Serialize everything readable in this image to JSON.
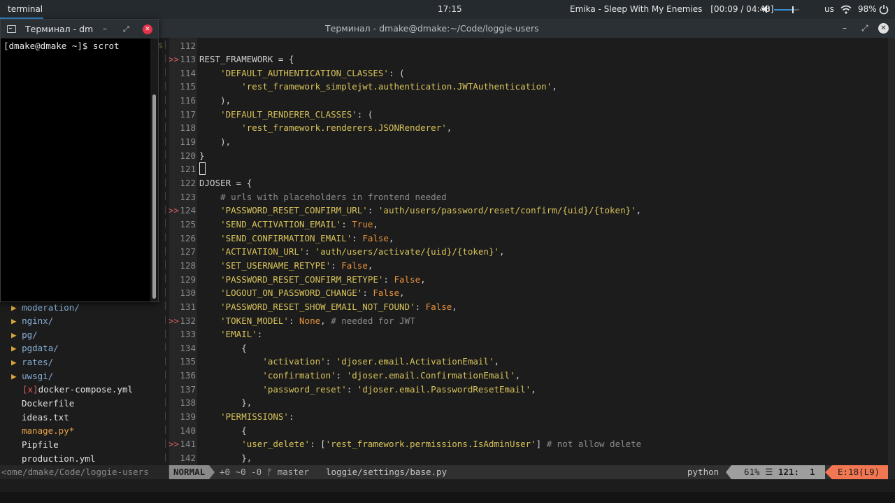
{
  "topbar": {
    "app_label": "terminal",
    "clock": "17:15",
    "media": {
      "artist": "Emika",
      "separator": "-",
      "track": "Sleep With My Enemies",
      "position": "[00:09 / 04:48]"
    },
    "volume_level": 0.75,
    "keyboard_layout": "us",
    "battery": "98%",
    "icons": [
      "volume-icon",
      "wifi-icon",
      "power-icon"
    ]
  },
  "window": {
    "title": "Терминал - dmake@dmake:~/Code/loggie-users",
    "minimize_glyph": "–",
    "maximize_glyph": "⤢",
    "close_glyph": "✕"
  },
  "float_terminal": {
    "title": "Терминал - dmake@dmake:~/Code/loggie-users",
    "prompt": "[dmake@dmake ~]$ scrot",
    "minimize_glyph": "–",
    "maximize_glyph": "⤢",
    "close_glyph": "✕"
  },
  "tree": {
    "marker": "s",
    "items": [
      {
        "arrow": "▶ ",
        "name": "moderation/",
        "type": "dir"
      },
      {
        "arrow": "▶ ",
        "name": "nginx/",
        "type": "dir"
      },
      {
        "arrow": "▶ ",
        "name": "pg/",
        "type": "dir"
      },
      {
        "arrow": "▶ ",
        "name": "pgdata/",
        "type": "dir"
      },
      {
        "arrow": "▶ ",
        "name": "rates/",
        "type": "dir"
      },
      {
        "arrow": "▶ ",
        "name": "uwsgi/",
        "type": "dir"
      },
      {
        "arrow": "",
        "flag": "[x]",
        "name": "docker-compose.yml",
        "type": "file"
      },
      {
        "arrow": "",
        "name": "Dockerfile",
        "type": "file"
      },
      {
        "arrow": "",
        "name": "ideas.txt",
        "type": "file"
      },
      {
        "arrow": "",
        "name": "manage.py*",
        "type": "modified"
      },
      {
        "arrow": "",
        "name": "Pipfile",
        "type": "file"
      },
      {
        "arrow": "",
        "name": "production.yml",
        "type": "file"
      }
    ]
  },
  "code": {
    "lines": [
      {
        "n": "112",
        "sign": "",
        "text": ""
      },
      {
        "n": "113",
        "sign": ">>",
        "text": "REST_FRAMEWORK = {"
      },
      {
        "n": "114",
        "sign": "",
        "text": "    'DEFAULT_AUTHENTICATION_CLASSES': ("
      },
      {
        "n": "115",
        "sign": "",
        "text": "        'rest_framework_simplejwt.authentication.JWTAuthentication',"
      },
      {
        "n": "116",
        "sign": "",
        "text": "    ),"
      },
      {
        "n": "117",
        "sign": "",
        "text": "    'DEFAULT_RENDERER_CLASSES': ("
      },
      {
        "n": "118",
        "sign": "",
        "text": "        'rest_framework.renderers.JSONRenderer',"
      },
      {
        "n": "119",
        "sign": "",
        "text": "    ),"
      },
      {
        "n": "120",
        "sign": "",
        "text": "}"
      },
      {
        "n": "121",
        "sign": "",
        "text": "",
        "cursor": true
      },
      {
        "n": "122",
        "sign": "",
        "text": "DJOSER = {"
      },
      {
        "n": "123",
        "sign": "",
        "text": "    # urls with placeholders in frontend needed"
      },
      {
        "n": "124",
        "sign": ">>",
        "text": "    'PASSWORD_RESET_CONFIRM_URL': 'auth/users/password/reset/confirm/{uid}/{token}',"
      },
      {
        "n": "125",
        "sign": "",
        "text": "    'SEND_ACTIVATION_EMAIL': True,"
      },
      {
        "n": "126",
        "sign": "",
        "text": "    'SEND_CONFIRMATION_EMAIL': False,"
      },
      {
        "n": "127",
        "sign": "",
        "text": "    'ACTIVATION_URL': 'auth/users/activate/{uid}/{token}',"
      },
      {
        "n": "128",
        "sign": "",
        "text": "    'SET_USERNAME_RETYPE': False,"
      },
      {
        "n": "129",
        "sign": "",
        "text": "    'PASSWORD_RESET_CONFIRM_RETYPE': False,"
      },
      {
        "n": "130",
        "sign": "",
        "text": "    'LOGOUT_ON_PASSWORD_CHANGE': False,"
      },
      {
        "n": "131",
        "sign": "",
        "text": "    'PASSWORD_RESET_SHOW_EMAIL_NOT_FOUND': False,"
      },
      {
        "n": "132",
        "sign": ">>",
        "text": "    'TOKEN_MODEL': None, # needed for JWT"
      },
      {
        "n": "133",
        "sign": "",
        "text": "    'EMAIL':"
      },
      {
        "n": "134",
        "sign": "",
        "text": "        {"
      },
      {
        "n": "135",
        "sign": "",
        "text": "            'activation': 'djoser.email.ActivationEmail',"
      },
      {
        "n": "136",
        "sign": "",
        "text": "            'confirmation': 'djoser.email.ConfirmationEmail',"
      },
      {
        "n": "137",
        "sign": "",
        "text": "            'password_reset': 'djoser.email.PasswordResetEmail',"
      },
      {
        "n": "138",
        "sign": "",
        "text": "        },"
      },
      {
        "n": "139",
        "sign": "",
        "text": "    'PERMISSIONS':"
      },
      {
        "n": "140",
        "sign": "",
        "text": "        {"
      },
      {
        "n": "141",
        "sign": ">>",
        "text": "        'user_delete': ['rest_framework.permissions.IsAdminUser'] # not allow delete"
      },
      {
        "n": "142",
        "sign": "",
        "text": "        },"
      }
    ]
  },
  "statusline": {
    "tree_path": "<ome/dmake/Code/loggie-users",
    "mode": "NORMAL",
    "git": "+0 ~0 -0 ᚠ master",
    "file": "loggie/settings/base.py",
    "filetype": "python",
    "percent": "61%",
    "lines_glyph": "☰",
    "position": "121:  1",
    "errors": "E:18(L9)"
  },
  "colors": {
    "string": "#d7c25a",
    "keyword": "#e8913a",
    "sign": "#d75f5f",
    "error_segment": "#f17652",
    "accent": "#3d8fd1"
  }
}
